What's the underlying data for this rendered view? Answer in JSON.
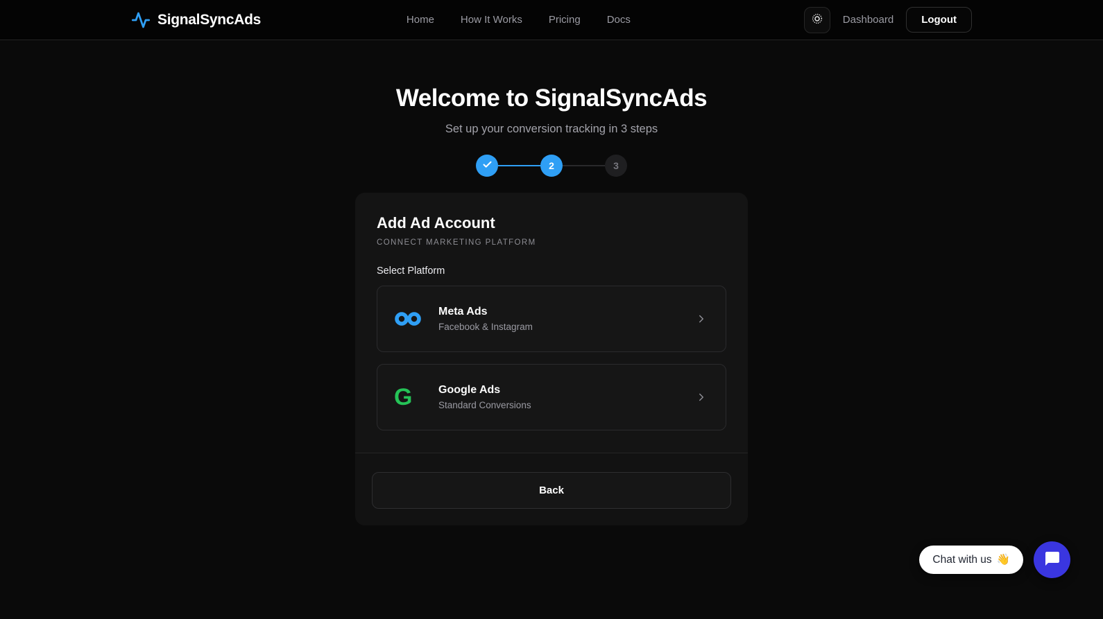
{
  "brand": {
    "name": "SignalSyncAds"
  },
  "nav": {
    "links": [
      "Home",
      "How It Works",
      "Pricing",
      "Docs"
    ],
    "dashboard_label": "Dashboard",
    "logout_label": "Logout"
  },
  "hero": {
    "title": "Welcome to SignalSyncAds",
    "subtitle": "Set up your conversion tracking in 3 steps"
  },
  "stepper": {
    "steps": [
      {
        "label": "",
        "state": "complete",
        "icon": "check-icon"
      },
      {
        "label": "2",
        "state": "current"
      },
      {
        "label": "3",
        "state": "upcoming"
      }
    ]
  },
  "card": {
    "title": "Add Ad Account",
    "eyebrow": "CONNECT MARKETING PLATFORM",
    "section_label": "Select Platform",
    "platforms": [
      {
        "name": "Meta Ads",
        "description": "Facebook & Instagram",
        "icon": "meta-infinity-icon",
        "icon_color": "#2f9ff5"
      },
      {
        "name": "Google Ads",
        "description": "Standard Conversions",
        "icon": "google-g-icon",
        "icon_color": "#25c357",
        "glyph": "G"
      }
    ],
    "back_label": "Back"
  },
  "chat": {
    "label": "Chat with us",
    "wave_emoji": "👋"
  },
  "colors": {
    "accent_blue": "#2f9ff5",
    "google_green": "#25c357",
    "chat_indigo": "#3a36e0",
    "step_inactive": "#1f1f21"
  }
}
